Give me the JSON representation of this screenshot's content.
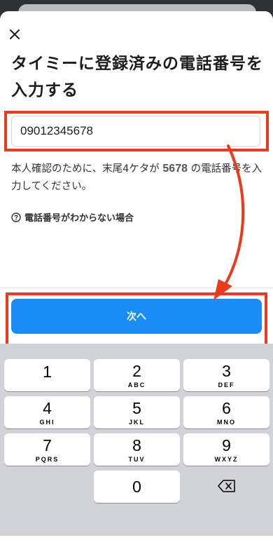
{
  "title": "タイミーに登録済みの電話番号を入力する",
  "phone": {
    "value": "09012345678",
    "placeholder": ""
  },
  "help": {
    "before": "本人確認のために、末尾4ケタが",
    "digits": "5678",
    "after": "の電話番号を入力してください。"
  },
  "unknown_link": "電話番号がわからない場合",
  "next_button": "次へ",
  "keypad": [
    {
      "digit": "1",
      "letters": ""
    },
    {
      "digit": "2",
      "letters": "ABC"
    },
    {
      "digit": "3",
      "letters": "DEF"
    },
    {
      "digit": "4",
      "letters": "GHI"
    },
    {
      "digit": "5",
      "letters": "JKL"
    },
    {
      "digit": "6",
      "letters": "MNO"
    },
    {
      "digit": "7",
      "letters": "PQRS"
    },
    {
      "digit": "8",
      "letters": "TUV"
    },
    {
      "digit": "9",
      "letters": "WXYZ"
    },
    {
      "digit": "0",
      "letters": ""
    }
  ],
  "colors": {
    "primary": "#1a8cf5",
    "annotation": "#ee3a1c"
  }
}
